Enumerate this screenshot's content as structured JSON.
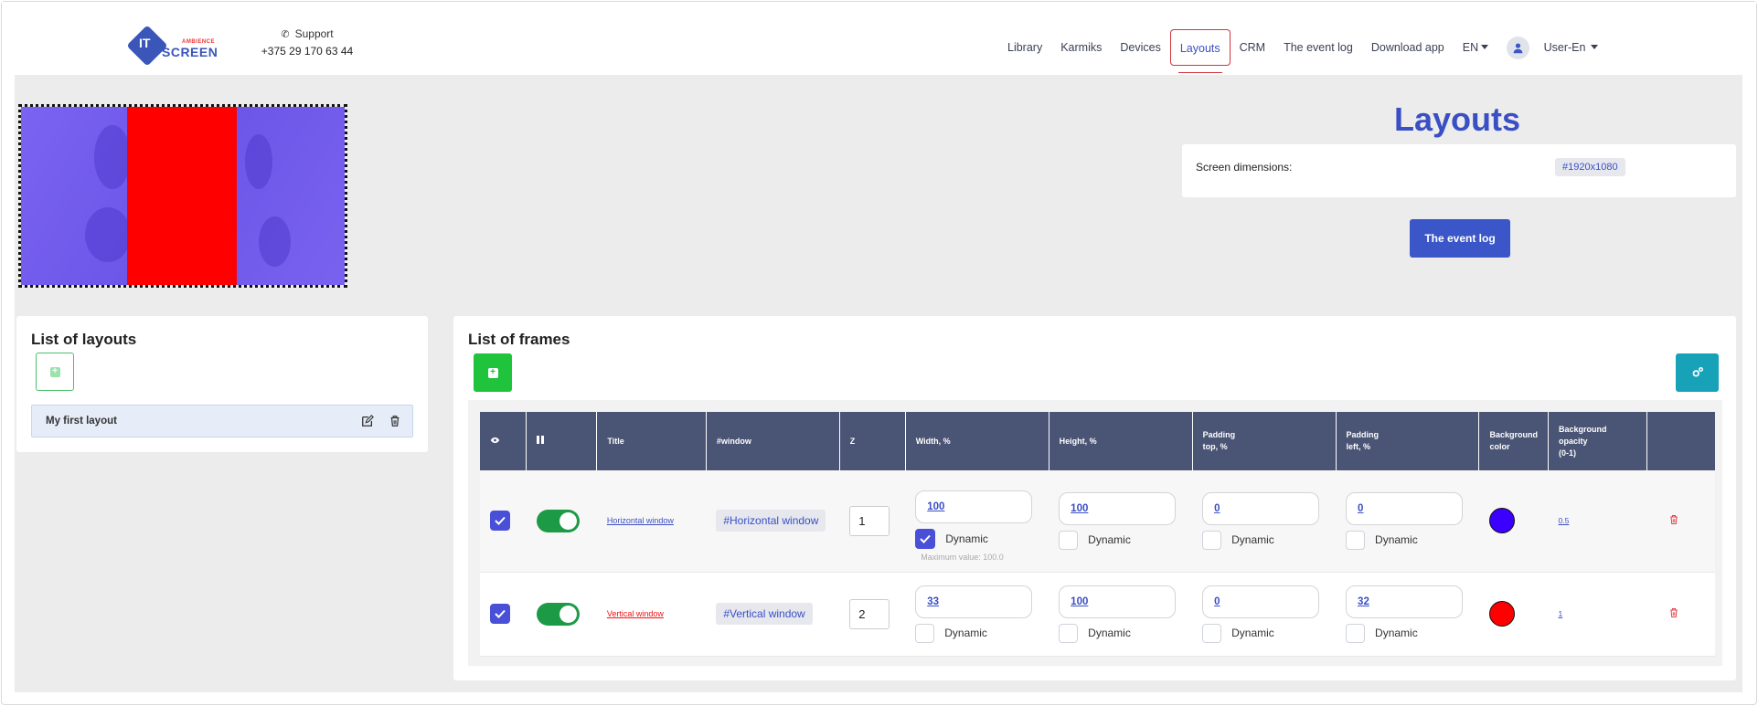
{
  "header": {
    "logo": {
      "it": "IT",
      "ambience": "AMBIENCE",
      "screen": "SCREEN"
    },
    "support_label": "Support",
    "support_phone": "+375 29 170 63 44",
    "nav": [
      {
        "label": "Library"
      },
      {
        "label": "Karmiks"
      },
      {
        "label": "Devices"
      },
      {
        "label": "Layouts",
        "active": true
      },
      {
        "label": "CRM"
      },
      {
        "label": "The event log"
      },
      {
        "label": "Download app"
      }
    ],
    "lang": "EN",
    "user": "User-En"
  },
  "page": {
    "title": "Layouts",
    "screen_dimensions_label": "Screen dimensions:",
    "screen_dimensions_value": "#1920x1080",
    "event_log_button": "The event log"
  },
  "layouts_panel": {
    "title": "List of layouts",
    "items": [
      {
        "label": "My first layout"
      }
    ]
  },
  "frames_panel": {
    "title": "List of frames",
    "columns": [
      "",
      "",
      "Title",
      "#window",
      "Z",
      "Width, %",
      "Height, %",
      "Padding top, %",
      "Padding left, %",
      "Background color",
      "Background opacity (0-1)",
      ""
    ],
    "col_labels": {
      "title": "Title",
      "window": "#window",
      "z": "Z",
      "width": "Width, %",
      "height": "Height, %",
      "padding_top_1": "Padding",
      "padding_top_2": "top, %",
      "padding_left_1": "Padding",
      "padding_left_2": "left, %",
      "bg_color_1": "Background",
      "bg_color_2": "color",
      "bg_opacity_1": "Background",
      "bg_opacity_2": "opacity",
      "bg_opacity_3": "(0-1)"
    },
    "dynamic_label": "Dynamic",
    "rows": [
      {
        "title": "Horizontal window",
        "window": "#Horizontal window",
        "z": "1",
        "width": "100",
        "width_dynamic": true,
        "width_hint": "Maximum value: 100.0",
        "height": "100",
        "padding_top": "0",
        "padding_left": "0",
        "bg_color": "#3b00ff",
        "opacity": "0.5"
      },
      {
        "title": "Vertical window",
        "window": "#Vertical window",
        "z": "2",
        "width": "33",
        "width_dynamic": false,
        "height": "100",
        "padding_top": "0",
        "padding_left": "32",
        "bg_color": "#ff0000",
        "opacity": "1"
      }
    ]
  },
  "colors": {
    "accent": "#3b4fc4",
    "danger": "#d0343d",
    "success": "#1fc33c",
    "info": "#17a2b8"
  }
}
